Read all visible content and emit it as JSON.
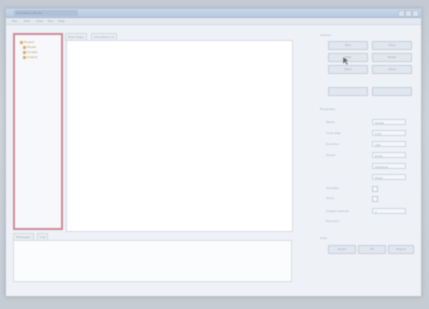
{
  "window": {
    "title": "Simulation Studio",
    "controls": [
      "minimize",
      "maximize",
      "close"
    ]
  },
  "menu": {
    "items": [
      "File",
      "Edit",
      "View",
      "Run",
      "Help"
    ]
  },
  "tree": {
    "items": [
      {
        "label": "Project",
        "icon": "folder-icon"
      },
      {
        "label": "Model",
        "icon": "folder-icon"
      },
      {
        "label": "Scripts",
        "icon": "folder-icon"
      },
      {
        "label": "Output",
        "icon": "folder-icon"
      }
    ]
  },
  "editor": {
    "tabs": [
      "Start Page",
      "simulation.cs"
    ]
  },
  "bottom": {
    "tabs": [
      "Messages",
      "Log"
    ]
  },
  "actions": {
    "title": "Actions",
    "buttons": [
      "Run",
      "Stop",
      "Step",
      "Reset",
      "Open",
      "Save"
    ]
  },
  "properties": {
    "title": "Properties",
    "rows": [
      {
        "label": "Name",
        "value": "Model"
      },
      {
        "label": "Time step",
        "value": "0.01"
      },
      {
        "label": "Duration",
        "value": "100"
      },
      {
        "label": "Solver",
        "value": "Euler"
      },
      {
        "label": "",
        "value": "Adaptive"
      },
      {
        "label": "",
        "value": "Fixed"
      }
    ],
    "checks": [
      "Animate",
      "Trace"
    ],
    "extra": [
      {
        "label": "Output interval",
        "value": "1"
      },
      {
        "label": "Precision",
        "value": ""
      }
    ]
  },
  "footer": {
    "title": "View",
    "buttons": [
      "Zoom",
      "Fit",
      "Export"
    ]
  },
  "colors": {
    "tree_border": "#d08b9a",
    "window_bg": "#eef1f6",
    "editor_bg": "#ffffff"
  }
}
